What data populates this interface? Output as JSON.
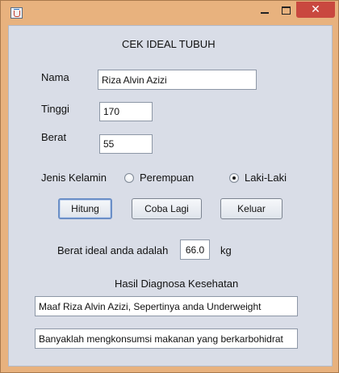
{
  "window": {
    "title": "",
    "close_glyph": "✕"
  },
  "form": {
    "heading": "CEK IDEAL TUBUH",
    "nama": {
      "label": "Nama",
      "value": "Riza Alvin Azizi"
    },
    "tinggi": {
      "label": "Tinggi",
      "value": "170"
    },
    "berat": {
      "label": "Berat",
      "value": "55"
    },
    "gender": {
      "label": "Jenis Kelamin",
      "options": [
        {
          "label": "Perempuan",
          "checked": false
        },
        {
          "label": "Laki-Laki",
          "checked": true
        }
      ]
    },
    "buttons": {
      "hitung": "Hitung",
      "coba_lagi": "Coba Lagi",
      "keluar": "Keluar"
    },
    "ideal": {
      "label": "Berat ideal anda adalah",
      "value": "66.0",
      "unit": "kg"
    },
    "diagnosis": {
      "heading": "Hasil Diagnosa Kesehatan",
      "line1": "Maaf Riza Alvin Azizi, Sepertinya anda Underweight",
      "line2": "Banyaklah mengkonsumsi makanan yang berkarbohidrat"
    }
  }
}
